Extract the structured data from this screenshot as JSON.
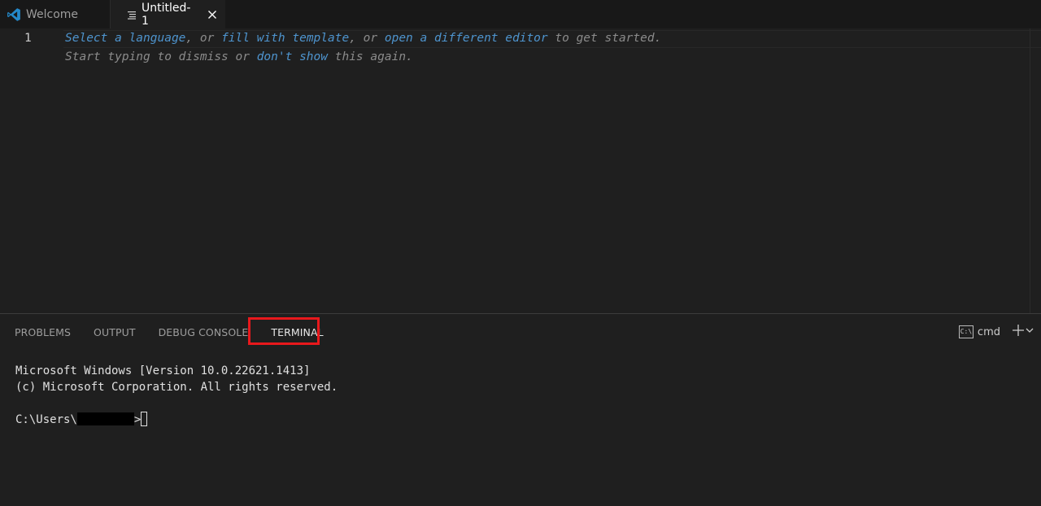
{
  "tabs": {
    "welcome_label": "Welcome",
    "untitled_label": "Untitled-1"
  },
  "editor": {
    "line_number": "1",
    "hint_line1": {
      "select_language": "Select a language",
      "sep1": ", or ",
      "fill_template": "fill with template",
      "sep2": ", or ",
      "open_editor": "open a different editor",
      "tail": " to get started."
    },
    "hint_line2": {
      "head": "Start typing to dismiss or ",
      "dont_show": "don't show",
      "tail": " this again."
    }
  },
  "panel": {
    "tabs": [
      "PROBLEMS",
      "OUTPUT",
      "DEBUG CONSOLE",
      "TERMINAL"
    ],
    "active_tab": "TERMINAL",
    "shell_icon_text": "C:\\",
    "shell_label": "cmd"
  },
  "terminal": {
    "line1": "Microsoft Windows [Version 10.0.22621.1413]",
    "line2": "(c) Microsoft Corporation. All rights reserved.",
    "prompt_prefix": "C:\\Users\\",
    "prompt_suffix": ">"
  },
  "colors": {
    "link": "#4e94ce",
    "highlight_box": "#e8181c",
    "vscode_blue": "#2489ca"
  }
}
